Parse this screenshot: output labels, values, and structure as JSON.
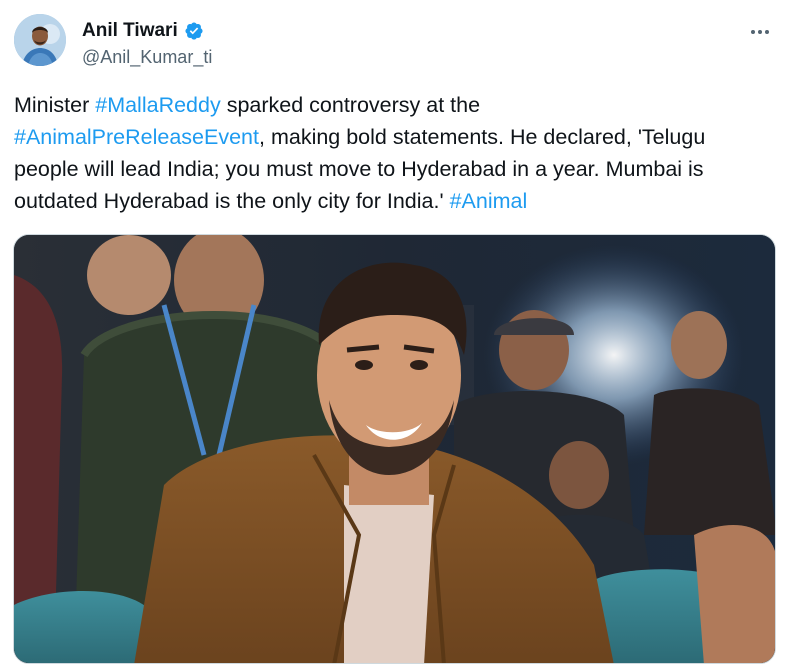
{
  "author": {
    "display_name": "Anil Tiwari",
    "handle": "@Anil_Kumar_ti",
    "verified_icon": "verified-badge-icon",
    "avatar_icon": "avatar"
  },
  "menu": {
    "icon": "more-options-icon"
  },
  "tweet": {
    "segments": [
      {
        "text": "Minister ",
        "hashtag": false
      },
      {
        "text": "#MallaReddy",
        "hashtag": true
      },
      {
        "text": " sparked controversy at the\n",
        "hashtag": false
      },
      {
        "text": "#AnimalPreReleaseEvent",
        "hashtag": true
      },
      {
        "text": ", making bold statements. He declared, 'Telugu\npeople will lead India; you must move to Hyderabad in a year. Mumbai is\noutdated Hyderabad is the only city for India.' ",
        "hashtag": false
      },
      {
        "text": "#Animal",
        "hashtag": true
      }
    ]
  },
  "colors": {
    "hashtag": "#1d9bf0",
    "text": "#0f1419",
    "secondary": "#536471",
    "verified": "#1d9bf0"
  }
}
